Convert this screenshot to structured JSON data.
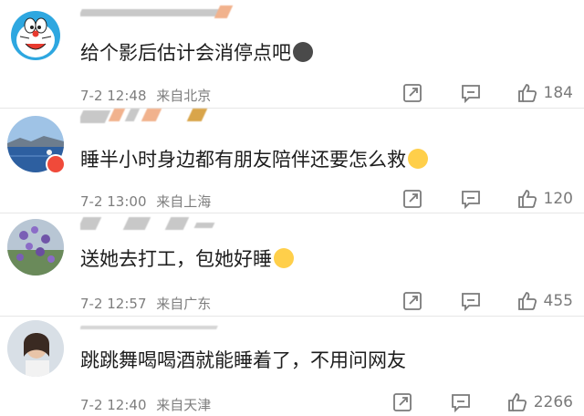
{
  "comments": [
    {
      "avatar": "doraemon-avatar",
      "name": "",
      "text": "给个影后估计会消停点吧",
      "emoji": "surprised-emoji",
      "date": "7-2 12:48",
      "location": "来自北京",
      "likes": "184"
    },
    {
      "avatar": "sea-landscape-avatar",
      "name": "",
      "text": "睡半小时身边都有朋友陪伴还要怎么救",
      "emoji": "laugh-cry-emoji",
      "date": "7-2 13:00",
      "location": "来自上海",
      "likes": "120"
    },
    {
      "avatar": "purple-flowers-avatar",
      "name": "",
      "text": "送她去打工，包她好睡",
      "emoji": "laugh-cry-emoji",
      "date": "7-2 12:57",
      "location": "来自广东",
      "likes": "455"
    },
    {
      "avatar": "person-photo-avatar",
      "name": "",
      "text": "跳跳舞喝喝酒就能睡着了，不用问网友",
      "emoji": "",
      "date": "7-2 12:40",
      "location": "来自天津",
      "likes": "2266"
    }
  ],
  "icons": {
    "share": "share-icon",
    "comment": "comment-icon",
    "like": "thumbs-up-icon"
  },
  "colors": {
    "text": "#1d1d1d",
    "meta": "#7e7e7e",
    "icon": "#7a7a7a",
    "verified_badge": "#f04a3a"
  }
}
